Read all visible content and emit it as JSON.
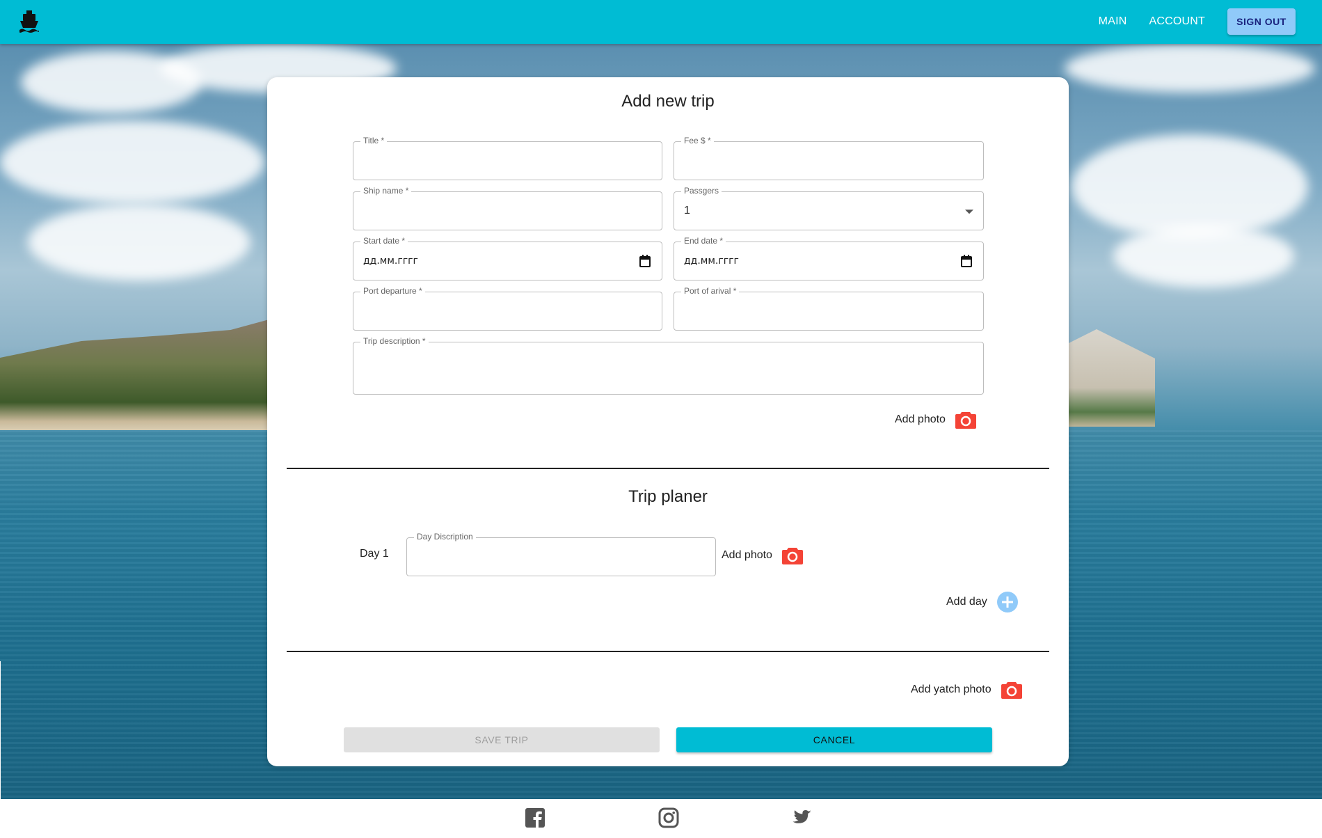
{
  "topbar": {
    "logo_icon": "ship-icon",
    "nav": {
      "main": "MAIN",
      "account": "ACCOUNT",
      "sign_out": "SIGN OUT"
    },
    "color": "#00bcd4",
    "sign_out_color": "#90caf9"
  },
  "form": {
    "title": "Add new trip",
    "fields": {
      "title": {
        "label": "Title *",
        "value": ""
      },
      "fee": {
        "label": "Fee $ *",
        "value": ""
      },
      "ship_name": {
        "label": "Ship name *",
        "value": ""
      },
      "passengers": {
        "label": "Passgers",
        "value": "1"
      },
      "start_date": {
        "label": "Start date *",
        "placeholder": "дд.мм.гггг"
      },
      "end_date": {
        "label": "End date *",
        "placeholder": "дд.мм.гггг"
      },
      "port_departure": {
        "label": "Port departure *",
        "value": ""
      },
      "port_arrival": {
        "label": "Port of arival *",
        "value": ""
      },
      "trip_description": {
        "label": "Trip description *",
        "value": ""
      }
    },
    "add_photo": "Add photo"
  },
  "planner": {
    "title": "Trip planer",
    "days": [
      {
        "label": "Day 1",
        "field_label": "Day Discription",
        "value": "",
        "add_photo": "Add photo"
      }
    ],
    "add_day": "Add day"
  },
  "yacht": {
    "add_photo": "Add yatch photo"
  },
  "buttons": {
    "save": "SAVE TRIP",
    "cancel": "CANCEL"
  },
  "footer": {
    "icons": [
      "facebook-icon",
      "instagram-icon",
      "twitter-icon"
    ]
  },
  "colors": {
    "camera": "#f44336",
    "add_day": "#90caf9"
  }
}
